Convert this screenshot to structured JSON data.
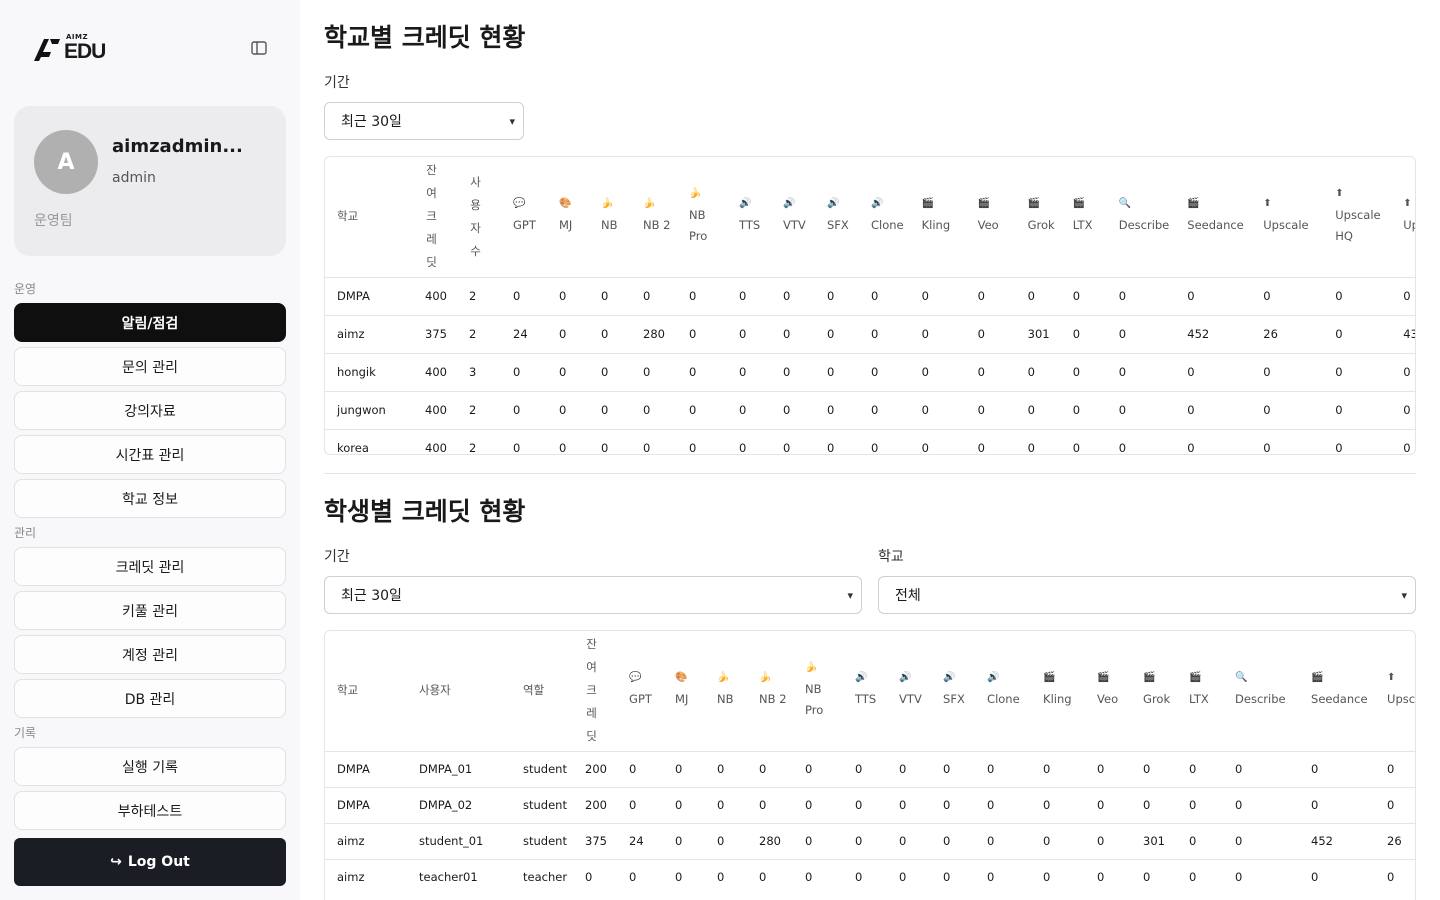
{
  "sidebar": {
    "logo_small": "AIMZ",
    "logo_big": "EDU",
    "profile": {
      "avatar_letter": "A",
      "name": "aimzadmin...",
      "role": "admin",
      "team": "운영팀"
    },
    "sections": [
      {
        "label": "운영",
        "items": [
          "알림/점검",
          "문의 관리",
          "강의자료",
          "시간표 관리",
          "학교 정보"
        ]
      },
      {
        "label": "관리",
        "items": [
          "크레딧 관리",
          "키풀 관리",
          "계정 관리",
          "DB 관리"
        ]
      },
      {
        "label": "기록",
        "items": [
          "실행 기록",
          "부하테스트"
        ]
      }
    ],
    "active_item": "알림/점검",
    "logout_label": "Log Out"
  },
  "school_section": {
    "title": "학교별 크레딧 현황",
    "period_label": "기간",
    "period_value": "최근 30일",
    "columns": [
      {
        "label": "학교"
      },
      {
        "label": "잔여크레딧",
        "vertical": true
      },
      {
        "label": "사용자수",
        "vertical": true
      },
      {
        "label": "GPT",
        "icon": "💬"
      },
      {
        "label": "MJ",
        "icon": "🎨"
      },
      {
        "label": "NB",
        "icon": "🍌"
      },
      {
        "label": "NB 2",
        "icon": "🍌"
      },
      {
        "label": "NB Pro",
        "icon": "🍌"
      },
      {
        "label": "TTS",
        "icon": "🔊"
      },
      {
        "label": "VTV",
        "icon": "🔊"
      },
      {
        "label": "SFX",
        "icon": "🔊"
      },
      {
        "label": "Clone",
        "icon": "🔊"
      },
      {
        "label": "Kling",
        "icon": "🎬"
      },
      {
        "label": "Veo",
        "icon": "🎬"
      },
      {
        "label": "Grok",
        "icon": "🎬"
      },
      {
        "label": "LTX",
        "icon": "🎬"
      },
      {
        "label": "Describe",
        "icon": "🔍"
      },
      {
        "label": "Seedance",
        "icon": "🎬"
      },
      {
        "label": "Upscale",
        "icon": "⬆"
      },
      {
        "label": "Upscale HQ",
        "icon": "⬆"
      },
      {
        "label": "Ups",
        "icon": "⬆"
      }
    ],
    "rows": [
      [
        "DMPA",
        "400",
        "2",
        "0",
        "0",
        "0",
        "0",
        "0",
        "0",
        "0",
        "0",
        "0",
        "0",
        "0",
        "0",
        "0",
        "0",
        "0",
        "0",
        "0",
        "0"
      ],
      [
        "aimz",
        "375",
        "2",
        "24",
        "0",
        "0",
        "280",
        "0",
        "0",
        "0",
        "0",
        "0",
        "0",
        "0",
        "301",
        "0",
        "0",
        "452",
        "26",
        "0",
        "43"
      ],
      [
        "hongik",
        "400",
        "3",
        "0",
        "0",
        "0",
        "0",
        "0",
        "0",
        "0",
        "0",
        "0",
        "0",
        "0",
        "0",
        "0",
        "0",
        "0",
        "0",
        "0",
        "0"
      ],
      [
        "jungwon",
        "400",
        "2",
        "0",
        "0",
        "0",
        "0",
        "0",
        "0",
        "0",
        "0",
        "0",
        "0",
        "0",
        "0",
        "0",
        "0",
        "0",
        "0",
        "0",
        "0"
      ],
      [
        "korea",
        "400",
        "2",
        "0",
        "0",
        "0",
        "0",
        "0",
        "0",
        "0",
        "0",
        "0",
        "0",
        "0",
        "0",
        "0",
        "0",
        "0",
        "0",
        "0",
        "0"
      ]
    ]
  },
  "student_section": {
    "title": "학생별 크레딧 현황",
    "period_label": "기간",
    "period_value": "최근 30일",
    "school_label": "학교",
    "school_value": "전체",
    "columns": [
      {
        "label": "학교"
      },
      {
        "label": "사용자"
      },
      {
        "label": "역할"
      },
      {
        "label": "잔여크레딧",
        "vertical": true
      },
      {
        "label": "GPT",
        "icon": "💬"
      },
      {
        "label": "MJ",
        "icon": "🎨"
      },
      {
        "label": "NB",
        "icon": "🍌"
      },
      {
        "label": "NB 2",
        "icon": "🍌"
      },
      {
        "label": "NB Pro",
        "icon": "🍌"
      },
      {
        "label": "TTS",
        "icon": "🔊"
      },
      {
        "label": "VTV",
        "icon": "🔊"
      },
      {
        "label": "SFX",
        "icon": "🔊"
      },
      {
        "label": "Clone",
        "icon": "🔊"
      },
      {
        "label": "Kling",
        "icon": "🎬"
      },
      {
        "label": "Veo",
        "icon": "🎬"
      },
      {
        "label": "Grok",
        "icon": "🎬"
      },
      {
        "label": "LTX",
        "icon": "🎬"
      },
      {
        "label": "Describe",
        "icon": "🔍"
      },
      {
        "label": "Seedance",
        "icon": "🎬"
      },
      {
        "label": "Upscal",
        "icon": "⬆"
      }
    ],
    "rows": [
      [
        "DMPA",
        "DMPA_01",
        "student",
        "200",
        "0",
        "0",
        "0",
        "0",
        "0",
        "0",
        "0",
        "0",
        "0",
        "0",
        "0",
        "0",
        "0",
        "0",
        "0",
        "0"
      ],
      [
        "DMPA",
        "DMPA_02",
        "student",
        "200",
        "0",
        "0",
        "0",
        "0",
        "0",
        "0",
        "0",
        "0",
        "0",
        "0",
        "0",
        "0",
        "0",
        "0",
        "0",
        "0"
      ],
      [
        "aimz",
        "student_01",
        "student",
        "375",
        "24",
        "0",
        "0",
        "280",
        "0",
        "0",
        "0",
        "0",
        "0",
        "0",
        "0",
        "301",
        "0",
        "0",
        "452",
        "26"
      ],
      [
        "aimz",
        "teacher01",
        "teacher",
        "0",
        "0",
        "0",
        "0",
        "0",
        "0",
        "0",
        "0",
        "0",
        "0",
        "0",
        "0",
        "0",
        "0",
        "0",
        "0",
        "0"
      ]
    ]
  }
}
